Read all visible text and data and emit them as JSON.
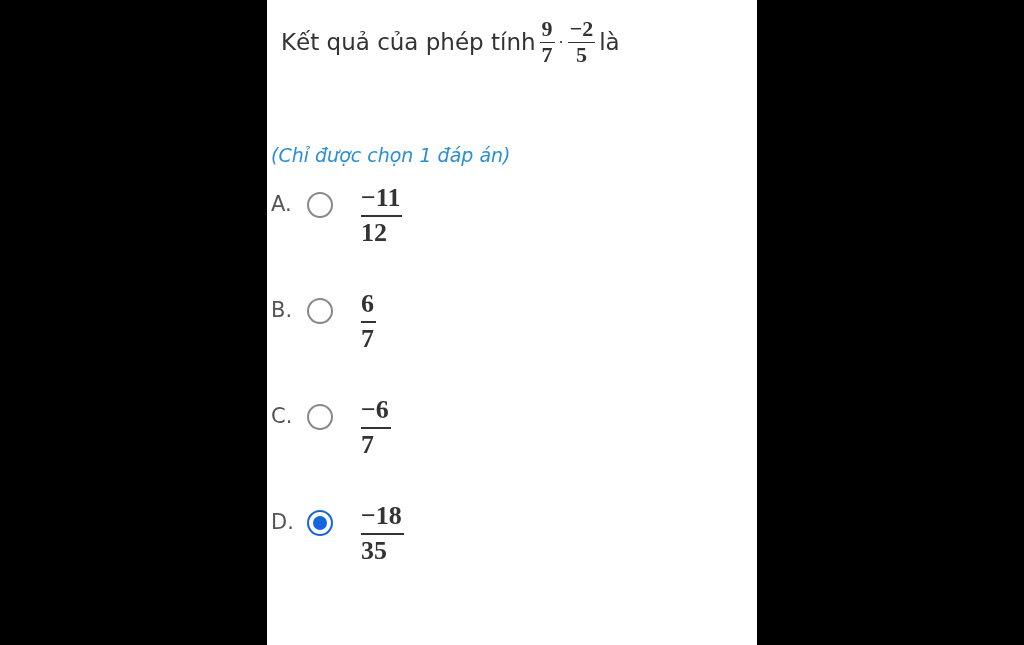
{
  "question": {
    "text": "Kết quả của phép tính",
    "fractions": [
      {
        "numerator": "9",
        "denominator": "7"
      },
      {
        "numerator": "−2",
        "denominator": "5"
      }
    ],
    "operator": "·",
    "suffix": "là"
  },
  "hint": "(Chỉ được chọn 1 đáp án)",
  "options": [
    {
      "letter": "A.",
      "numerator": "−11",
      "denominator": "12",
      "selected": false
    },
    {
      "letter": "B.",
      "numerator": "6",
      "denominator": "7",
      "selected": false
    },
    {
      "letter": "C.",
      "numerator": "−6",
      "denominator": "7",
      "selected": false
    },
    {
      "letter": "D.",
      "numerator": "−18",
      "denominator": "35",
      "selected": true
    }
  ]
}
